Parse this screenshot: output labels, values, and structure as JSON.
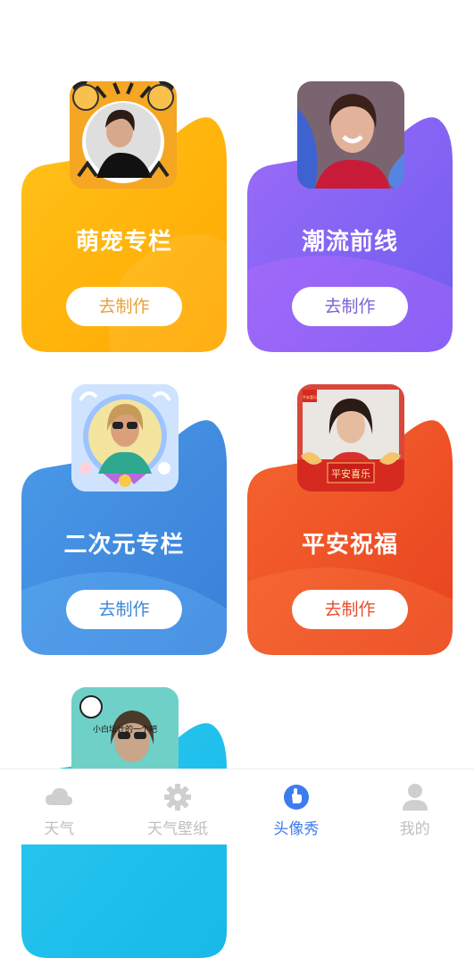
{
  "cards": [
    {
      "title": "萌宠专栏",
      "button": "去制作",
      "color": "#ffb300",
      "button_color": "#e6a23c"
    },
    {
      "title": "潮流前线",
      "button": "去制作",
      "color": "#8a5cf6",
      "button_color": "#7b61d9"
    },
    {
      "title": "二次元专栏",
      "button": "去制作",
      "color": "#3d8ee8",
      "button_color": "#3b86d6"
    },
    {
      "title": "平安祝福",
      "button": "去制作",
      "color": "#f0522a",
      "button_color": "#e94c2e"
    }
  ],
  "avatar_overlay_text": {
    "card5": "小白坛计的一个吧",
    "card4_banner": "平安喜乐",
    "card4_corner": "平安喜乐"
  },
  "nav": {
    "items": [
      {
        "label": "天气",
        "icon": "cloud-icon",
        "active": false
      },
      {
        "label": "天气壁纸",
        "icon": "gear-icon",
        "active": false
      },
      {
        "label": "头像秀",
        "icon": "hand-icon",
        "active": true
      },
      {
        "label": "我的",
        "icon": "user-icon",
        "active": false
      }
    ],
    "active_color": "#3d7bf0",
    "inactive_color": "#bfbfbf"
  }
}
